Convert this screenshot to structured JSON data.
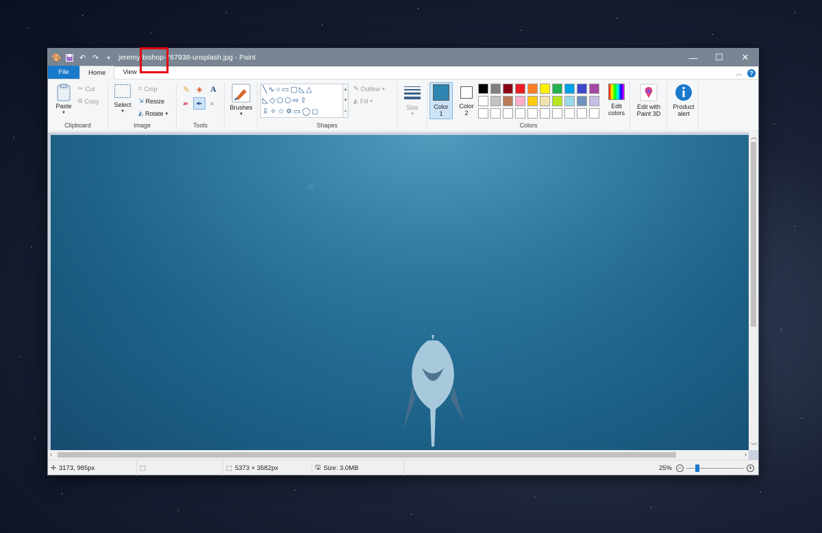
{
  "window": {
    "title": "jeremy-bishop-767938-unsplash.jpg - Paint",
    "quick_access_icons": [
      "paint-app-icon",
      "save-icon",
      "undo-icon",
      "redo-icon",
      "customize-icon"
    ],
    "controls": {
      "minimize": "—",
      "maximize": "☐",
      "close": "✕"
    }
  },
  "menu": {
    "file": "File",
    "tabs": [
      "Home",
      "View"
    ],
    "active_tab": "Home"
  },
  "ribbon": {
    "clipboard": {
      "label": "Clipboard",
      "paste": "Paste",
      "cut": "Cut",
      "copy": "Copy"
    },
    "image": {
      "label": "Image",
      "select": "Select",
      "crop": "Crop",
      "resize": "Resize",
      "rotate": "Rotate"
    },
    "tools": {
      "label": "Tools",
      "selected": "color-picker"
    },
    "brushes": {
      "label": "Brushes"
    },
    "shapes": {
      "label": "Shapes",
      "outline": "Outline",
      "fill": "Fill"
    },
    "size": {
      "label": "Size"
    },
    "colors": {
      "label": "Colors",
      "color1_label": "Color",
      "color1_num": "1",
      "color2_label": "Color",
      "color2_num": "2",
      "color1": "#2e86b3",
      "color2": "#ffffff",
      "edit_colors_1": "Edit",
      "edit_colors_2": "colors",
      "palette_row1": [
        "#000000",
        "#7f7f7f",
        "#880015",
        "#ed1c24",
        "#ff7f27",
        "#fff200",
        "#22b14c",
        "#00a2e8",
        "#3f48cc",
        "#a349a4"
      ],
      "palette_row2": [
        "#ffffff",
        "#c3c3c3",
        "#b97a57",
        "#ffaec9",
        "#ffc90e",
        "#efe4b0",
        "#b5e61d",
        "#99d9ea",
        "#7092be",
        "#c8bfe7"
      ],
      "palette_row3": [
        "#ffffff",
        "#ffffff",
        "#ffffff",
        "#ffffff",
        "#ffffff",
        "#ffffff",
        "#ffffff",
        "#ffffff",
        "#ffffff",
        "#ffffff"
      ]
    },
    "paint3d": {
      "line1": "Edit with",
      "line2": "Paint 3D"
    },
    "product_alert": {
      "line1": "Product",
      "line2": "alert"
    }
  },
  "status": {
    "cursor_pos": "3173, 985px",
    "image_size": "5373 × 3582px",
    "file_size": "Size: 3.0MB",
    "zoom": "25%",
    "zoom_level": 0.25
  }
}
